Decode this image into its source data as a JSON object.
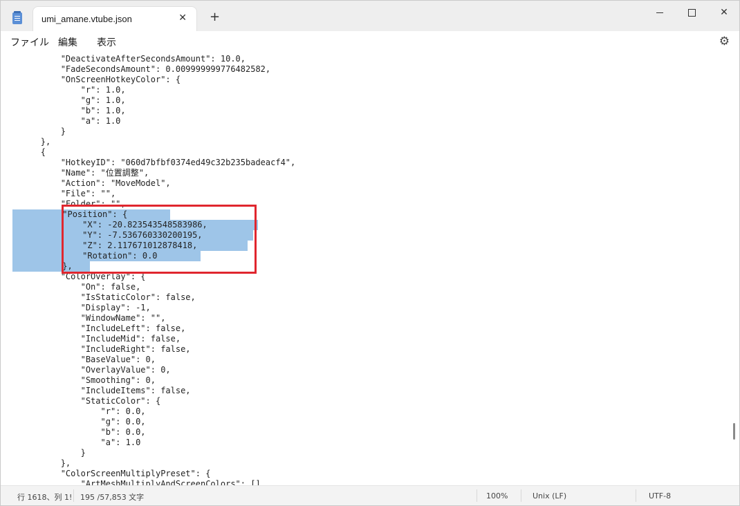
{
  "window": {
    "tab_title": "umi_amane.vtube.json",
    "tab_close": "✕",
    "new_tab": "+",
    "close_glyph": "✕"
  },
  "menu": {
    "file": "ファイル",
    "edit": "編集",
    "view": "表示"
  },
  "settings_icon": "⚙",
  "editor": {
    "lines": [
      "            \"DeactivateAfterSecondsAmount\": 10.0,",
      "            \"FadeSecondsAmount\": 0.009999999776482582,",
      "            \"OnScreenHotkeyColor\": {",
      "                \"r\": 1.0,",
      "                \"g\": 1.0,",
      "                \"b\": 1.0,",
      "                \"a\": 1.0",
      "            }",
      "        },",
      "        {",
      "            \"HotkeyID\": \"060d7bfbf0374ed49c32b235badeacf4\",",
      "            \"Name\": \"位置調整\",",
      "            \"Action\": \"MoveModel\",",
      "            \"File\": \"\",",
      "            \"Folder\": \"\",",
      "            \"Position\": {",
      "                \"X\": -20.823543548583986,",
      "                \"Y\": -7.536760330200195,",
      "                \"Z\": 2.117671012878418,",
      "                \"Rotation\": 0.0",
      "            },",
      "            \"ColorOverlay\": {",
      "                \"On\": false,",
      "                \"IsStaticColor\": false,",
      "                \"Display\": -1,",
      "                \"WindowName\": \"\",",
      "                \"IncludeLeft\": false,",
      "                \"IncludeMid\": false,",
      "                \"IncludeRight\": false,",
      "                \"BaseValue\": 0,",
      "                \"OverlayValue\": 0,",
      "                \"Smoothing\": 0,",
      "                \"IncludeItems\": false,",
      "                \"StaticColor\": {",
      "                    \"r\": 0.0,",
      "                    \"g\": 0.0,",
      "                    \"b\": 0.0,",
      "                    \"a\": 1.0",
      "                }",
      "            },",
      "            \"ColorScreenMultiplyPreset\": {",
      "                \"ArtMeshMultiplyAndScreenColors\": []"
    ],
    "selected_lines": [
      15,
      16,
      17,
      18,
      19,
      20
    ]
  },
  "status": {
    "position": "行 1618、列 1!",
    "char_count": "195 /57,853 文字",
    "zoom": "100%",
    "line_ending": "Unix (LF)",
    "encoding": "UTF-8"
  }
}
